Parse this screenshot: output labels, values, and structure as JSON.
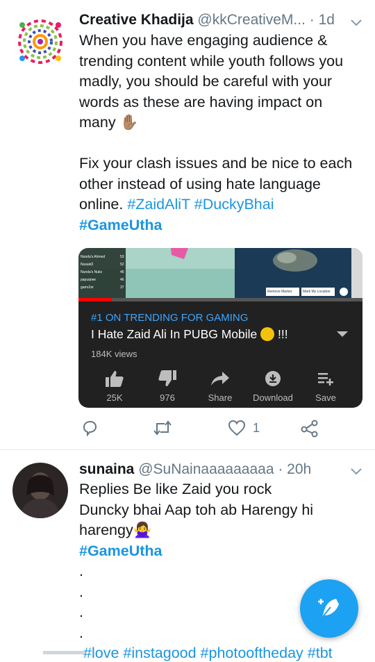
{
  "tweet1": {
    "name": "Creative Khadija",
    "handle": "@kkCreativeM...",
    "time": "· 1d",
    "lines": [
      "When you have engaging audience &",
      "trending content while youth follows you",
      "madly, you should be careful with your",
      "words as these are having impact on",
      "many"
    ],
    "emoji_hand": "✋🏽",
    "para2_lines": [
      "Fix your clash issues and be nice to each",
      "other instead of using hate language"
    ],
    "para2_end": "online.",
    "tags": [
      "#ZaidAliT",
      "#DuckyBhai"
    ],
    "tag_bold": "#GameUtha",
    "video": {
      "trending": "#1 ON TRENDING FOR GAMING",
      "title": "I Hate Zaid Ali In PUBG Mobile",
      "title_suffix": "!!!",
      "views": "184K views",
      "actions": [
        {
          "icon": "thumbs-up-icon",
          "label": "25K"
        },
        {
          "icon": "thumbs-down-icon",
          "label": "976"
        },
        {
          "icon": "share-icon",
          "label": "Share"
        },
        {
          "icon": "download-icon",
          "label": "Download"
        },
        {
          "icon": "save-playlist-icon",
          "label": "Save"
        }
      ],
      "scoreboard": [
        "Nunda's Ahmed",
        "Nusaid2",
        "Nunda's Nuks",
        "papuqrwe",
        "gamrZer"
      ],
      "scores": [
        "53",
        "52",
        "46",
        "46",
        "37"
      ],
      "map_buttons": [
        "Remove Marker",
        "Mark My Location"
      ]
    },
    "like_count": "1"
  },
  "tweet2": {
    "name": "sunaina",
    "handle": "@SuNainaaaaaaaaa",
    "time": "· 20h",
    "lines": [
      "Replies Be like Zaid you rock",
      "Duncky bhai Aap toh ab Harengy hi"
    ],
    "line3": "harengy",
    "emoji": "🙅‍♀️",
    "tag_bold": "#GameUtha",
    "dots": [
      ".",
      ".",
      ".",
      "."
    ],
    "bottom_tags": "#love #instagood #photooftheday #tbt"
  },
  "colors": {
    "link": "#1b95e0",
    "fab": "#1da1f2",
    "yt_blue": "#3ea6ff"
  }
}
